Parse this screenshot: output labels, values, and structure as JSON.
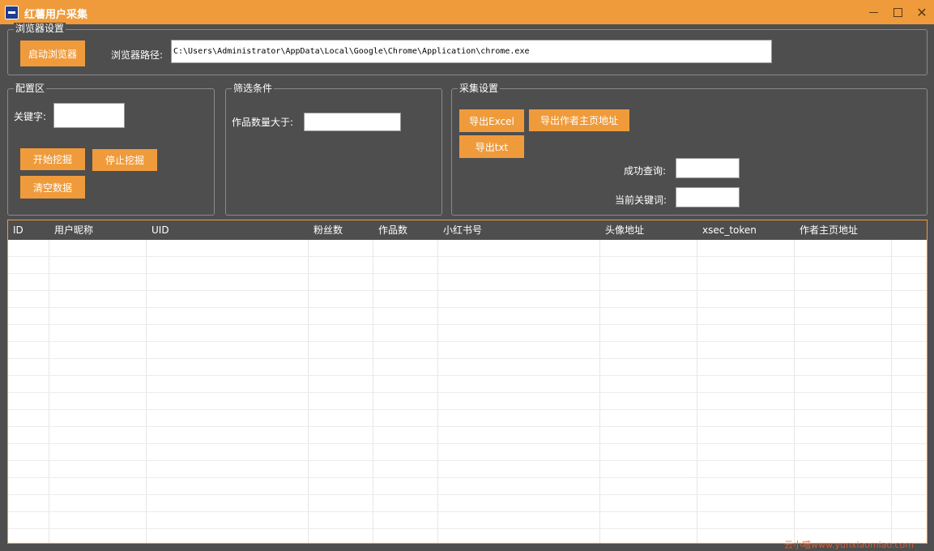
{
  "window": {
    "title": "红薯用户采集"
  },
  "browser_settings": {
    "group_title": "浏览器设置",
    "launch_button": "启动浏览器",
    "path_label": "浏览器路径:",
    "path_value": "C:\\Users\\Administrator\\AppData\\Local\\Google\\Chrome\\Application\\chrome.exe"
  },
  "config": {
    "group_title": "配置区",
    "keyword_label": "关键字:",
    "keyword_value": "",
    "start_button": "开始挖掘",
    "stop_button": "停止挖掘",
    "clear_button": "清空数据"
  },
  "filter": {
    "group_title": "筛选条件",
    "works_gt_label": "作品数量大于:",
    "works_gt_value": ""
  },
  "collect": {
    "group_title": "采集设置",
    "export_excel_button": "导出Excel",
    "export_homepage_button": "导出作者主页地址",
    "export_txt_button": "导出txt",
    "success_label": "成功查询:",
    "success_value": "",
    "current_keyword_label": "当前关键词:",
    "current_keyword_value": ""
  },
  "table": {
    "columns": [
      "ID",
      "用户昵称",
      "UID",
      "粉丝数",
      "作品数",
      "小红书号",
      "头像地址",
      "xsec_token",
      "作者主页地址"
    ],
    "rows": []
  },
  "watermark": "云小喵www.yunxiaomiao.com",
  "colors": {
    "accent": "#ef9b3c",
    "background": "#4e4e4e",
    "group_border": "#8a8a8a"
  }
}
